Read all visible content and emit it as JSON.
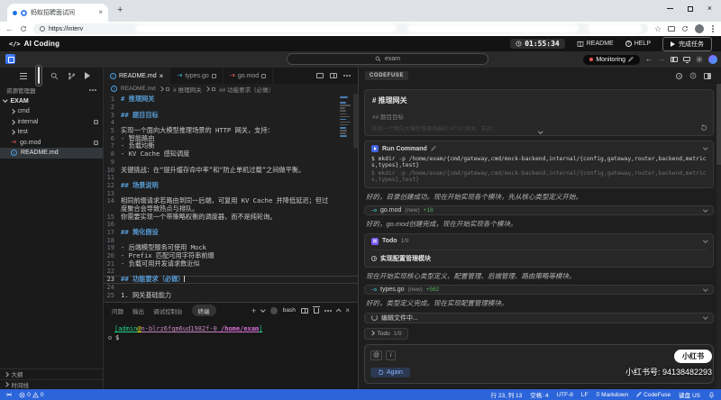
{
  "icons": {
    "logo": "</>",
    "back": "←",
    "star": "☆",
    "plus": "+",
    "close": "×",
    "at": "@",
    "italic": "i",
    "info": "i",
    "go": "-o",
    "braces": "{}",
    "remote": "><",
    "question": "?",
    "dollar": "$"
  },
  "browser": {
    "tab_title": "蚂蚁招聘面试间",
    "url": "https://interv"
  },
  "topbar": {
    "app_name": "AI Coding",
    "timer": "01:55:34",
    "readme": "README",
    "help": "HELP",
    "finish": "完成任务"
  },
  "titlebar": {
    "workspace": "exam",
    "monitoring": "Monitoring"
  },
  "sidebar": {
    "explorer": "资源管理器",
    "root": "EXAM",
    "items": [
      {
        "label": "cmd"
      },
      {
        "label": "internal"
      },
      {
        "label": "test"
      },
      {
        "label": "go.mod"
      },
      {
        "label": "README.md"
      }
    ],
    "outline": "大纲",
    "timeline": "时间线"
  },
  "editor": {
    "tabs": [
      {
        "label": "README.md"
      },
      {
        "label": "types.go"
      },
      {
        "label": "go.mod"
      }
    ],
    "breadcrumb": {
      "file": "README.md",
      "h1": "# 推理网关",
      "h2": "## 功能要求（必做）"
    },
    "rows": [
      {
        "num": "1",
        "text": "# 推理网关",
        "cls": "mdh"
      },
      {
        "num": "2",
        "text": ""
      },
      {
        "num": "3",
        "text": "## 题目目标",
        "cls": "mdh"
      },
      {
        "num": "4",
        "text": ""
      },
      {
        "num": "5",
        "text": "实现一个面向大模型推理场景的 HTTP 网关，支持："
      },
      {
        "num": "6",
        "text": "- 智能路由"
      },
      {
        "num": "7",
        "text": "- 负载均衡"
      },
      {
        "num": "8",
        "text": "- KV Cache 感知调度"
      },
      {
        "num": "9",
        "text": ""
      },
      {
        "num": "10",
        "text": "关键挑战：在“提升缓存命中率”和“防止单机过载”之间做平衡。"
      },
      {
        "num": "11",
        "text": ""
      },
      {
        "num": "12",
        "text": "## 场景说明",
        "cls": "mdh"
      },
      {
        "num": "13",
        "text": ""
      },
      {
        "num": "14",
        "text": "相同前缀请求若路由到同一后端，可复用 KV Cache 并降低延迟；但过"
      },
      {
        "num": "",
        "text": "度聚合会导致热点与排队。"
      },
      {
        "num": "15",
        "text": "你需要实现一个带策略权衡的调度器，而不是纯轮询。"
      },
      {
        "num": "16",
        "text": ""
      },
      {
        "num": "17",
        "text": "## 简化假设",
        "cls": "mdh"
      },
      {
        "num": "18",
        "text": ""
      },
      {
        "num": "19",
        "text": "- 后端模型服务可使用 Mock"
      },
      {
        "num": "20",
        "text": "- Prefix 匹配可用字符串前缀"
      },
      {
        "num": "21",
        "text": "- 负载可用并发请求数近似"
      },
      {
        "num": "22",
        "text": ""
      },
      {
        "num": "23",
        "text": "## 功能要求（必做）",
        "cls": "mdh cur"
      },
      {
        "num": "24",
        "text": ""
      },
      {
        "num": "25",
        "text": "1. 网关基础能力"
      }
    ]
  },
  "terminal": {
    "tabs": {
      "problems": "问题",
      "output": "输出",
      "debug": "调试控制台",
      "terminal": "终端"
    },
    "shell": "bash",
    "prompt": {
      "user": "[admin",
      "at": "@",
      "host": "n-blrz6fqm6ud1982f-0",
      "path": " /home/exam",
      "close": "]"
    }
  },
  "panel": {
    "title": "CODEFUSE",
    "quote": {
      "h1": "# 推理网关",
      "h2": "## 题目目标",
      "fade": "实现一个面向大模型推理场景的 HTTP 网关，支持："
    },
    "run": {
      "title": "Run Command",
      "cmd1": "$ mkdir -p /home/exam/{cmd/gateway,cmd/mock-backend,internal/{config,gateway,router,backend,metrics,types},test}",
      "cmd2": "$ mkdir -p /home/exam/{cmd/gateway,cmd/mock-backend,internal/{config,gateway,router,backend,metrics,types},test}"
    },
    "msg1": "好的，目录创建成功。现在开始实现各个模块，先从核心类型定义开始。",
    "file1": {
      "name": "go.mod",
      "tag": "(new)",
      "diff": "+18"
    },
    "msg2": "好的，go.mod创建完成，现在开始实现各个模块。",
    "todo": {
      "label": "Todo",
      "count": "1/9",
      "item": "实现配置管理模块"
    },
    "msg3": "现在开始实现核心类型定义、配置管理、后端管理、路由策略等模块。",
    "file2": {
      "name": "types.go",
      "tag": "(new)",
      "diff": "+562"
    },
    "msg4": "好的，类型定义完成。现在实现配置管理模块。",
    "editing": "编辑文件中...",
    "todo_collapsed": {
      "label": "Todo",
      "count": "1/9"
    },
    "again": "Again"
  },
  "watermark": {
    "pill": "小红书",
    "id": "小红书号: 94138482293"
  },
  "statusbar": {
    "errors": "0",
    "warnings": "0",
    "line_col": "行 23, 列 13",
    "spaces": "空格: 4",
    "encoding": "UTF-8",
    "eol": "LF",
    "language": "Markdown",
    "assistant": "CodeFuse",
    "keyboard": "键盘 US"
  }
}
